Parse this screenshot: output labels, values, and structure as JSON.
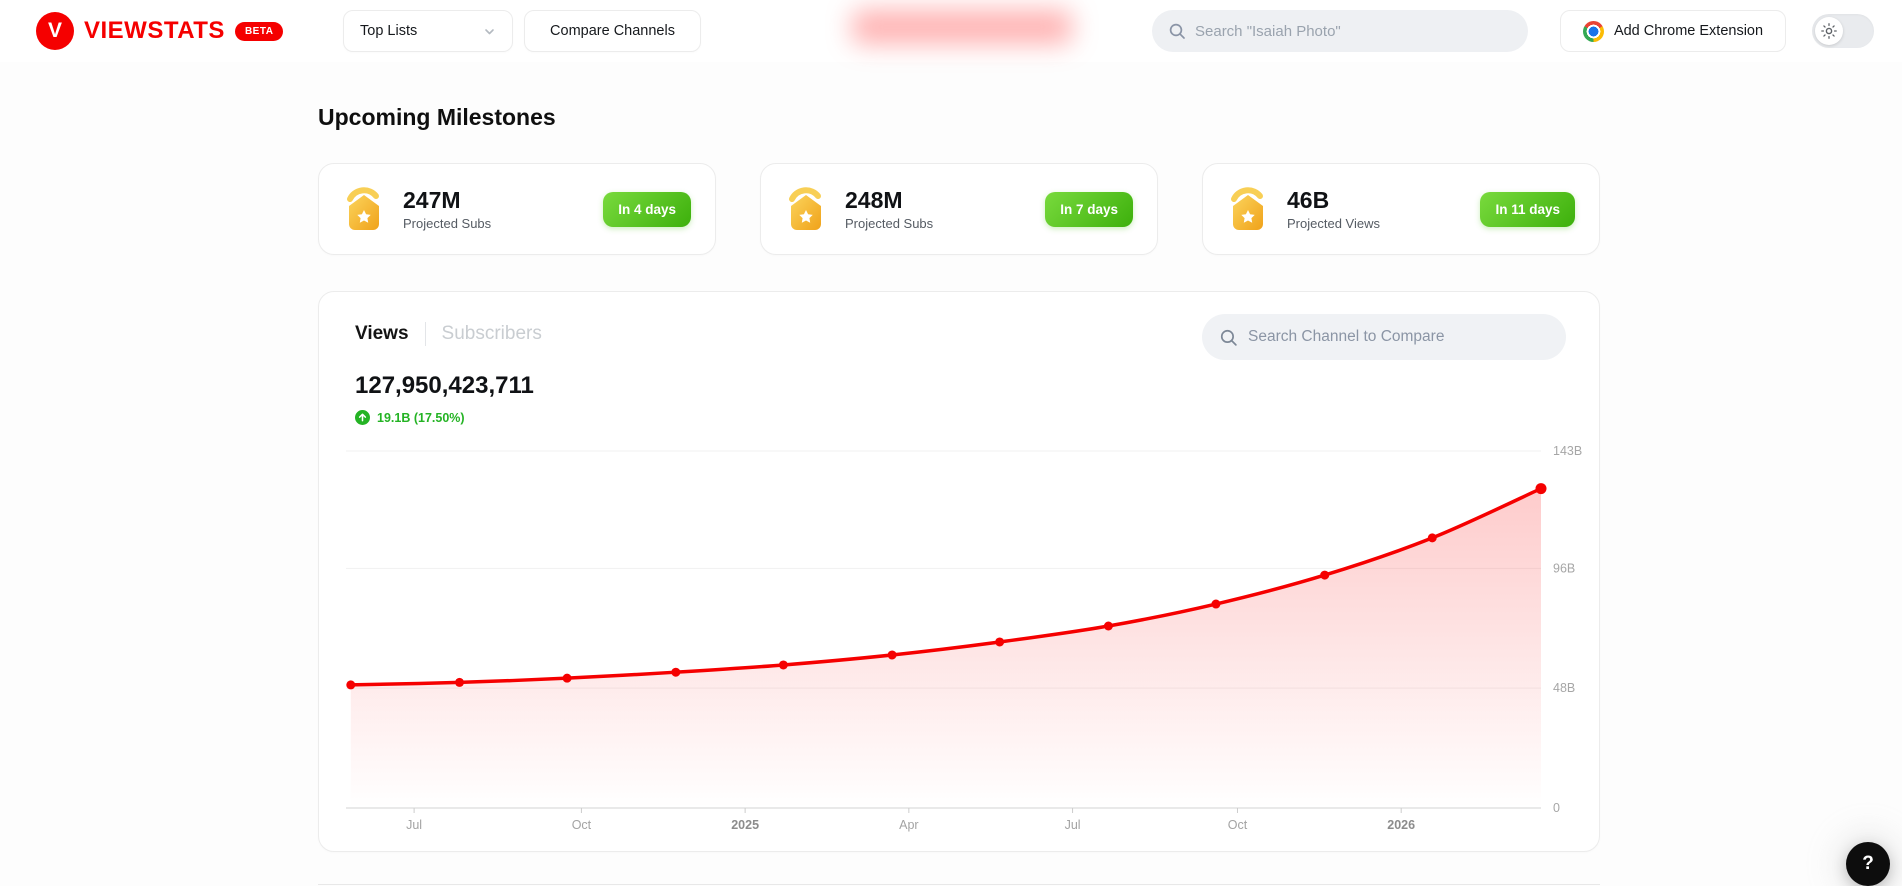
{
  "header": {
    "brand": {
      "logo_letter": "V",
      "name": "VIEWSTATS",
      "beta": "BETA"
    },
    "nav": {
      "top_lists": "Top Lists",
      "compare_channels": "Compare Channels"
    },
    "search_placeholder": "Search \"Isaiah Photo\"",
    "chrome_button": "Add Chrome Extension"
  },
  "milestones": {
    "title": "Upcoming Milestones",
    "cards": [
      {
        "value": "247M",
        "label": "Projected Subs",
        "badge": "In 4 days"
      },
      {
        "value": "248M",
        "label": "Projected Subs",
        "badge": "In 7 days"
      },
      {
        "value": "46B",
        "label": "Projected Views",
        "badge": "In 11 days"
      }
    ]
  },
  "stats": {
    "tabs": [
      {
        "label": "Views",
        "active": true
      },
      {
        "label": "Subscribers",
        "active": false
      }
    ],
    "total": "127,950,423,711",
    "delta": "19.1B (17.50%)",
    "compare_placeholder": "Search Channel to Compare"
  },
  "chart_data": {
    "type": "area",
    "series_name": "Views",
    "unit": "billions",
    "ylim": [
      0,
      143
    ],
    "line_color": "#f50000",
    "area_from": "rgba(250,20,20,0.22)",
    "area_to": "rgba(250,20,20,0)",
    "y_ticks": [
      {
        "label": "143B",
        "value": 143
      },
      {
        "label": "96B",
        "value": 96
      },
      {
        "label": "48B",
        "value": 48
      },
      {
        "label": "0",
        "value": 0
      }
    ],
    "x_ticks": [
      {
        "label": "Jul",
        "frac": 0.057,
        "bold": false
      },
      {
        "label": "Oct",
        "frac": 0.197,
        "bold": false
      },
      {
        "label": "2025",
        "frac": 0.334,
        "bold": true
      },
      {
        "label": "Apr",
        "frac": 0.471,
        "bold": false
      },
      {
        "label": "Jul",
        "frac": 0.608,
        "bold": false
      },
      {
        "label": "Oct",
        "frac": 0.746,
        "bold": false
      },
      {
        "label": "2026",
        "frac": 0.883,
        "bold": true
      }
    ],
    "x_frac": [
      0.004,
      0.095,
      0.185,
      0.276,
      0.366,
      0.457,
      0.547,
      0.638,
      0.728,
      0.819,
      0.909,
      1.0
    ],
    "values": [
      49.3,
      50.3,
      52.0,
      54.4,
      57.3,
      61.3,
      66.5,
      72.9,
      81.7,
      93.3,
      108.2,
      127.95
    ]
  },
  "help_label": "?"
}
